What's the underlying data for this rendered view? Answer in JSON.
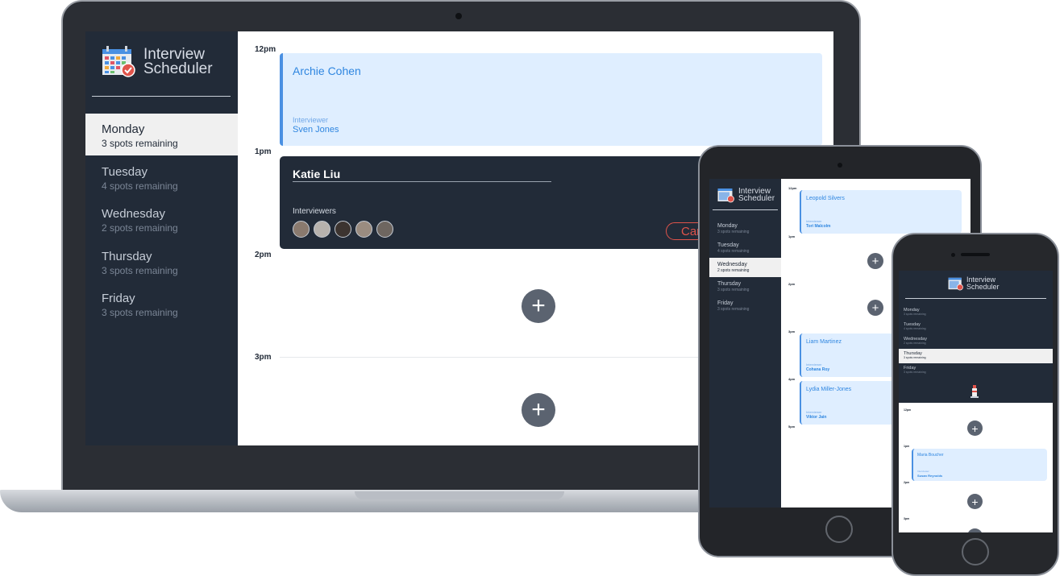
{
  "app": {
    "title_line1": "Interview",
    "title_line2": "Scheduler"
  },
  "laptop": {
    "days": [
      {
        "name": "Monday",
        "spots": "3 spots remaining",
        "selected": true
      },
      {
        "name": "Tuesday",
        "spots": "4 spots remaining",
        "selected": false
      },
      {
        "name": "Wednesday",
        "spots": "2 spots remaining",
        "selected": false
      },
      {
        "name": "Thursday",
        "spots": "3 spots remaining",
        "selected": false
      },
      {
        "name": "Friday",
        "spots": "3 spots remaining",
        "selected": false
      }
    ],
    "times": [
      "12pm",
      "1pm",
      "2pm",
      "3pm"
    ],
    "appointment": {
      "student": "Archie Cohen",
      "interviewer_label": "Interviewer",
      "interviewer": "Sven Jones"
    },
    "form": {
      "student_value": "Katie Liu",
      "interviewers_label": "Interviewers",
      "cancel_label": "Cancel"
    }
  },
  "tablet": {
    "days": [
      {
        "name": "Monday",
        "spots": "3 spots remaining"
      },
      {
        "name": "Tuesday",
        "spots": "4 spots remaining"
      },
      {
        "name": "Wednesday",
        "spots": "2 spots remaining"
      },
      {
        "name": "Thursday",
        "spots": "3 spots remaining"
      },
      {
        "name": "Friday",
        "spots": "3 spots remaining"
      }
    ],
    "times": [
      "12pm",
      "1pm",
      "2pm",
      "3pm",
      "4pm",
      "5pm"
    ],
    "appointments": [
      {
        "student": "Leopold Silvers",
        "interviewer_label": "Interviewer",
        "interviewer": "Tori Malcolm"
      },
      {
        "student": "Liam Martinez",
        "interviewer_label": "Interviewer",
        "interviewer": "Cohana Roy"
      },
      {
        "student": "Lydia Miller-Jones",
        "interviewer_label": "Interviewer",
        "interviewer": "Viktor Jain"
      }
    ]
  },
  "phone": {
    "days": [
      {
        "name": "Monday",
        "spots": "3 spots remaining"
      },
      {
        "name": "Tuesday",
        "spots": "4 spots remaining"
      },
      {
        "name": "Wednesday",
        "spots": "2 spots remaining"
      },
      {
        "name": "Thursday",
        "spots": "3 spots remaining"
      },
      {
        "name": "Friday",
        "spots": "3 spots remaining"
      }
    ],
    "times": [
      "12pm",
      "1pm",
      "2pm",
      "3pm"
    ],
    "appointment": {
      "student": "Maria Boucher",
      "interviewer_label": "Interviewer",
      "interviewer": "Susan Reynolds"
    }
  },
  "colors": {
    "sidebar": "#222b38",
    "accent_blue": "#2f86e0",
    "appointment_bg": "#dfeeff",
    "danger": "#e0544b"
  },
  "icons": {
    "logo": "calendar-check-icon",
    "add": "plus-icon"
  }
}
